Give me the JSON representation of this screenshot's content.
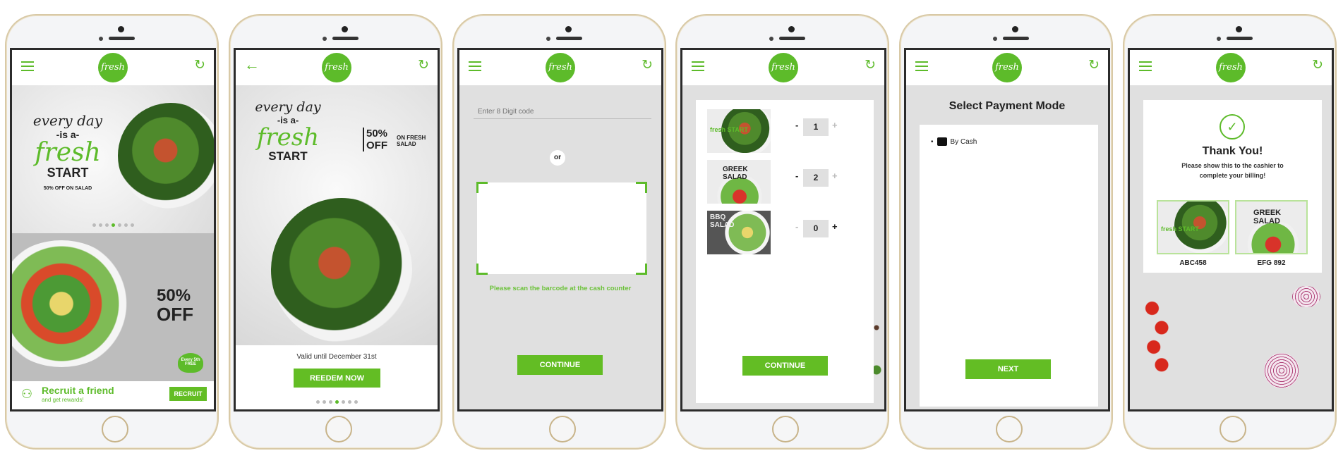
{
  "brand": {
    "logo_text": "fresh",
    "accent": "#63bd24"
  },
  "icons": {
    "menu": "hamburger-icon",
    "refresh": "refresh-icon",
    "back": "arrow-left-icon"
  },
  "screen1": {
    "banner": {
      "line1": "every day",
      "line2": "-is a-",
      "line3": "fresh",
      "line4": "START",
      "promo": "50% OFF ON SALAD"
    },
    "offer": {
      "percent": "50%",
      "off": "OFF",
      "badge": "Every 5th FREE"
    },
    "carousel": {
      "count": 7,
      "active": 4
    },
    "recruit": {
      "title": "Recruit a friend",
      "subtitle": "and get rewards!",
      "button": "RECRUIT"
    }
  },
  "screen2": {
    "banner": {
      "line1": "every day",
      "line2": "-is a-",
      "line3": "fresh",
      "line4": "START",
      "offer": "50% OFF",
      "offer_sub": "ON FRESH SALAD"
    },
    "valid": "Valid until December 31st",
    "button": "REEDEM NOW",
    "carousel": {
      "count": 7,
      "active": 4
    }
  },
  "screen3": {
    "code_placeholder": "Enter 8 Digit code",
    "or": "or",
    "scan_hint": "Please scan the barcode at the cash counter",
    "button": "CONTINUE"
  },
  "screen4": {
    "items": [
      {
        "label": "fresh START",
        "qty": "1"
      },
      {
        "label": "GREEK SALAD",
        "qty": "2"
      },
      {
        "label": "BBQ SALAD",
        "qty": "0"
      }
    ],
    "minus": "-",
    "plus": "+",
    "button": "CONTINUE"
  },
  "screen5": {
    "title": "Select Payment Mode",
    "options": [
      {
        "label": "By Cash",
        "icon": "wallet-icon"
      }
    ],
    "button": "NEXT"
  },
  "screen6": {
    "title": "Thank You!",
    "message": "Please show this to the cashier to complete your billing!",
    "coupons": [
      {
        "label": "fresh START",
        "code": "ABC458"
      },
      {
        "label": "GREEK SALAD",
        "code": "EFG 892"
      }
    ]
  }
}
